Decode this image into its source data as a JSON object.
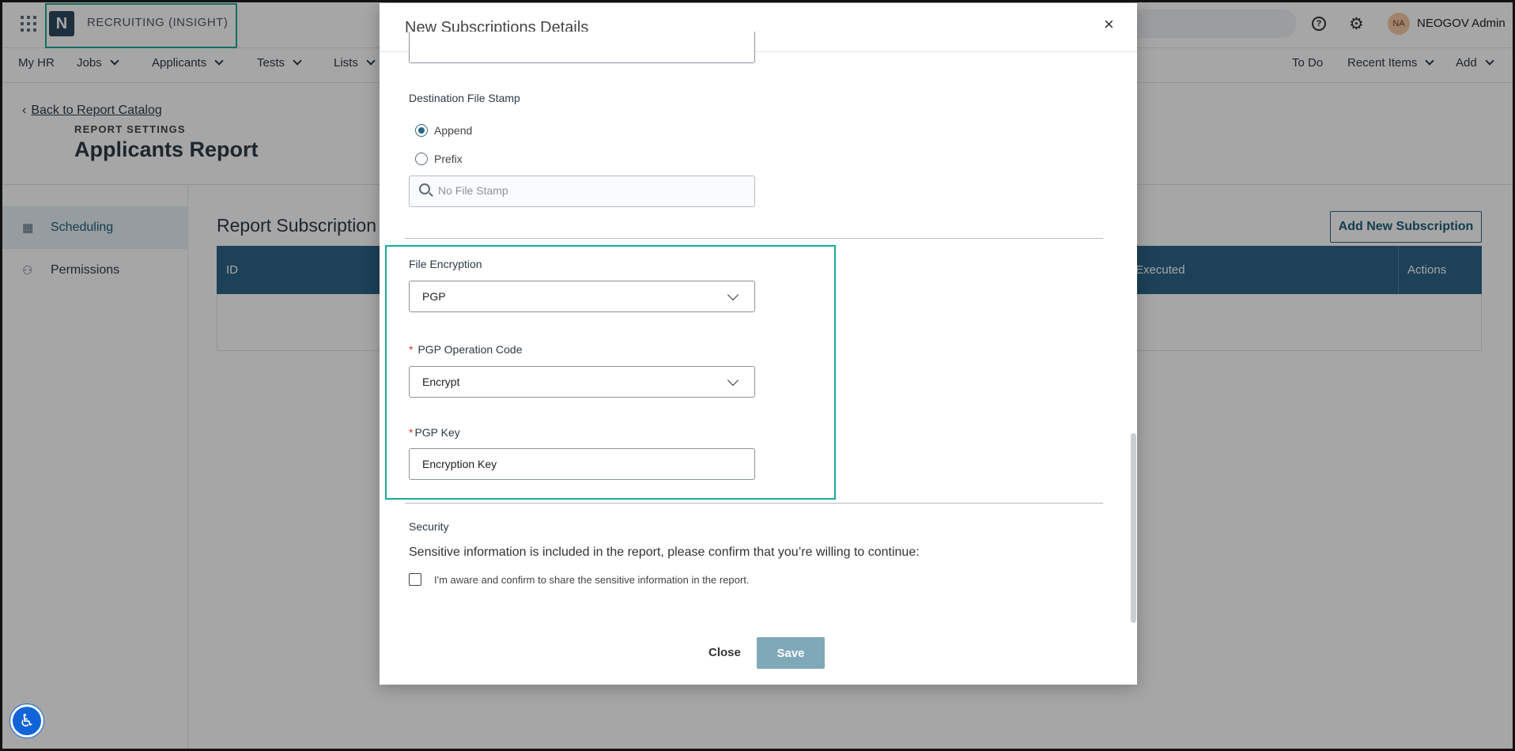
{
  "topbar": {
    "brand_letter": "N",
    "brand_text": "RECRUITING (INSIGHT)",
    "help_glyph": "?",
    "user_initials": "NA",
    "user_name": "NEOGOV Admin"
  },
  "nav": {
    "items": [
      "My HR",
      "Jobs",
      "Applicants",
      "Tests",
      "Lists"
    ],
    "right_items": [
      "To Do",
      "Recent Items",
      "Add"
    ]
  },
  "header": {
    "back_link": "Back to Report Catalog",
    "settings_label": "REPORT SETTINGS",
    "page_title": "Applicants Report"
  },
  "sidebar": {
    "items": [
      {
        "label": "Scheduling",
        "icon": "calendar-icon",
        "active": true
      },
      {
        "label": "Permissions",
        "icon": "users-icon",
        "active": false
      }
    ]
  },
  "content": {
    "section_title": "Report Subscription",
    "add_button": "Add New Subscription",
    "table_headers": [
      "ID",
      "Executed",
      "Actions"
    ]
  },
  "modal": {
    "title": "New Subscriptions Details",
    "close_glyph": "×",
    "destination_file_stamp_label": "Destination File Stamp",
    "stamp_options": [
      {
        "label": "Append",
        "checked": true
      },
      {
        "label": "Prefix",
        "checked": false
      }
    ],
    "stamp_search_placeholder": "No File Stamp",
    "file_encryption_label": "File Encryption",
    "file_encryption_value": "PGP",
    "pgp_operation_label": "PGP Operation Code",
    "pgp_operation_value": "Encrypt",
    "pgp_key_label": "PGP Key",
    "pgp_key_value": "Encryption Key",
    "required_mark": "*",
    "security_title": "Security",
    "security_text": "Sensitive information is included in the report, please confirm that you’re willing to continue:",
    "confirm_label": "I'm aware and confirm to share the sensitive information in the report.",
    "close_button": "Close",
    "save_button": "Save"
  },
  "colors": {
    "primary": "#2b6587",
    "highlight": "#1aa99a",
    "save_disabled": "#7fa8b9",
    "required": "#d8342b"
  }
}
